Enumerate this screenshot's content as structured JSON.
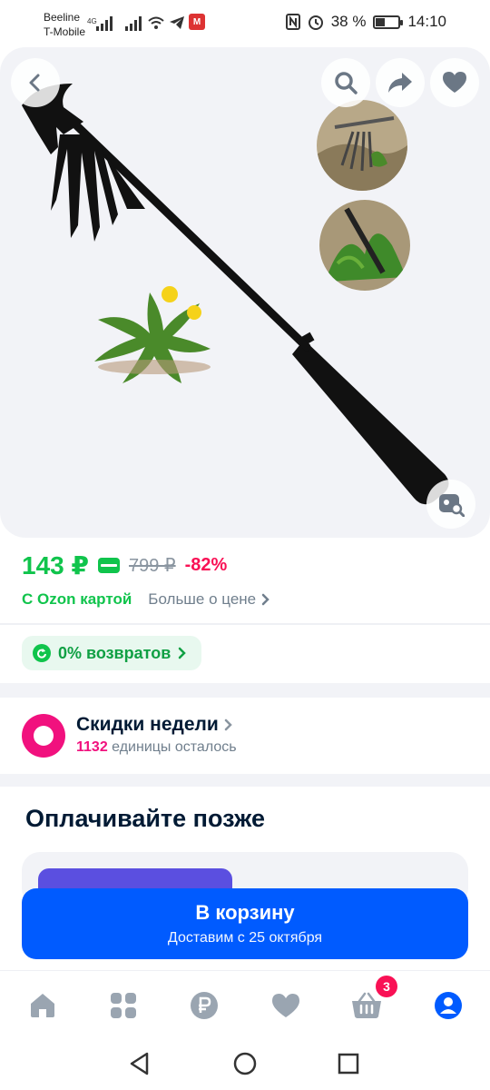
{
  "status_bar": {
    "carrier1": "Beeline",
    "carrier2": "T-Mobile",
    "network": "4G",
    "battery": "38 %",
    "battery_level": 0.38,
    "time": "14:10"
  },
  "gallery": {
    "icons": [
      "back-icon",
      "search-icon",
      "share-icon",
      "heart-icon",
      "image-search-icon"
    ]
  },
  "price": {
    "current": "143 ₽",
    "old": "799 ₽",
    "discount": "-82%",
    "ozon_card": "С Ozon картой",
    "more": "Больше о цене"
  },
  "returns": {
    "label": "0% возвратов"
  },
  "deals": {
    "title": "Скидки недели",
    "count": "1132",
    "remaining": "единицы осталось"
  },
  "pay_later": {
    "title": "Оплачивайте позже"
  },
  "cart": {
    "title": "В корзину",
    "delivery": "Доставим с 25 октября"
  },
  "tabbar": {
    "cart_badge": "3",
    "icons": [
      "home-icon",
      "catalog-icon",
      "ruble-icon",
      "favorites-icon",
      "cart-icon",
      "profile-icon"
    ]
  },
  "colors": {
    "accent_blue": "#005bff",
    "price_green": "#10c44c",
    "discount_pink": "#f91155",
    "deal_magenta": "#f1117e"
  }
}
